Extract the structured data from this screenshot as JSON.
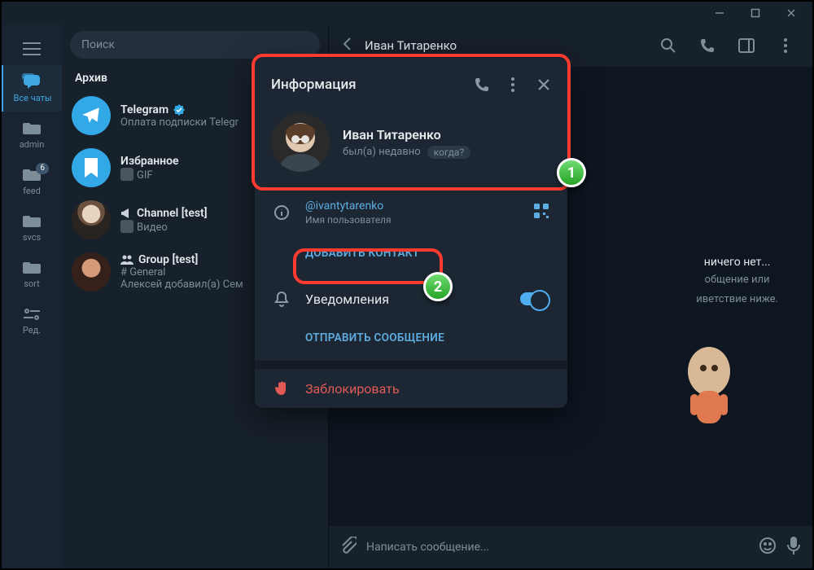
{
  "titlebar": {},
  "rail": {
    "items": [
      {
        "label": "Все чаты"
      },
      {
        "label": "admin"
      },
      {
        "label": "feed",
        "badge": "6"
      },
      {
        "label": "svcs"
      },
      {
        "label": "sort"
      },
      {
        "label": "Ред."
      }
    ]
  },
  "search": {
    "placeholder": "Поиск"
  },
  "archive": "Архив",
  "chats": [
    {
      "name": "Telegram",
      "sub": "Оплата подписки Telegr",
      "verified": true
    },
    {
      "name": "Избранное",
      "sub": "GIF"
    },
    {
      "name": "Channel [test]",
      "sub": "Видео",
      "speaker": true
    },
    {
      "name": "Group [test]",
      "sub1": "# General",
      "sub2": "Алексей добавил(а) Сем",
      "group": true
    }
  ],
  "header": {
    "title": "Иван Титаренко"
  },
  "empty": {
    "title": "ничего нет...",
    "line1": "общение или",
    "line2": "иветствие ниже."
  },
  "composer": {
    "placeholder": "Написать сообщение..."
  },
  "modal": {
    "title": "Информация",
    "name": "Иван Титаренко",
    "status": "был(а) недавно",
    "when": "когда?",
    "username": "@ivantytarenko",
    "username_label": "Имя пользователя",
    "add_contact": "ДОБАВИТЬ КОНТАКТ",
    "notifications": "Уведомления",
    "send_message": "ОТПРАВИТЬ СООБЩЕНИЕ",
    "block": "Заблокировать"
  },
  "markers": {
    "m1": "1",
    "m2": "2"
  }
}
